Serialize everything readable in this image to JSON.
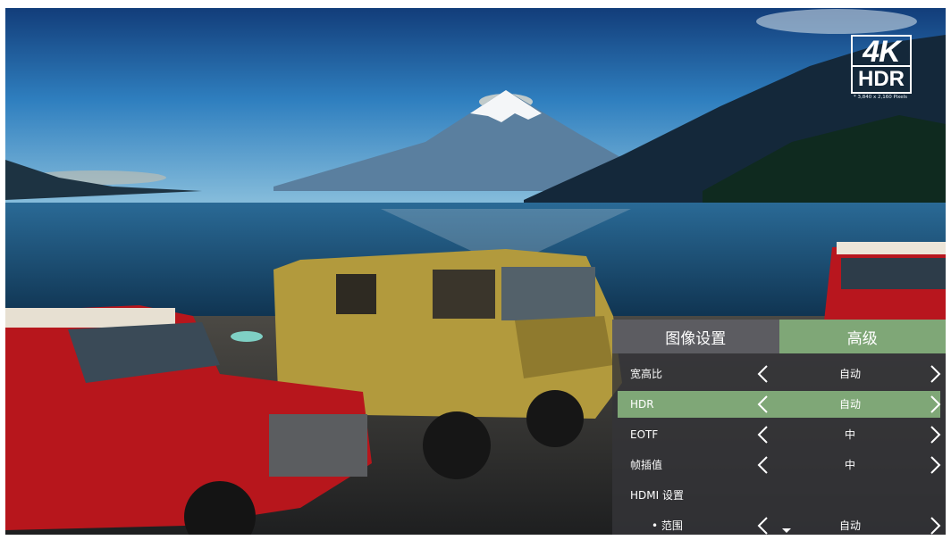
{
  "badge": {
    "line1": "4K",
    "line2": "HDR",
    "note": "* 3,840 x 2,160 Pixels"
  },
  "panel": {
    "tabs": [
      {
        "label": "图像设置",
        "active": false
      },
      {
        "label": "高级",
        "active": true
      }
    ],
    "rows": [
      {
        "label": "宽高比",
        "value": "自动",
        "selected": false
      },
      {
        "label": "HDR",
        "value": "自动",
        "selected": true
      },
      {
        "label": "EOTF",
        "value": "中",
        "selected": false
      },
      {
        "label": "帧插值",
        "value": "中",
        "selected": false
      },
      {
        "label": "HDMI 设置",
        "selected": false
      },
      {
        "label": "• 范围",
        "value": "自动",
        "selected": false
      }
    ]
  },
  "icons": {
    "left": "chevron-left-icon",
    "right": "chevron-right-icon",
    "more": "arrow-down-icon"
  },
  "colors": {
    "accent": "#7fa777",
    "tab_inactive": "#5c5c61",
    "panel_bg": "#343438"
  }
}
